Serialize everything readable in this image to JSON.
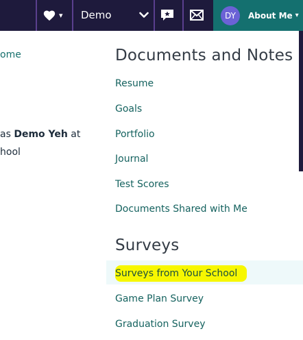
{
  "topbar": {
    "school": "Demo",
    "avatar_initials": "DY",
    "about_label": "About Me",
    "caret": "▾",
    "colors": {
      "bg": "#1e1a3c",
      "accent": "#14706f",
      "avatar": "#6b62d6"
    },
    "icons": [
      "heart-icon",
      "chevron-down-icon",
      "chat-icon",
      "mail-icon"
    ]
  },
  "left_partial": {
    "home_fragment": "ome",
    "logged_prefix": "as ",
    "logged_name": "Demo Yeh",
    "logged_suffix": " at",
    "school_fragment": "hool"
  },
  "documents": {
    "title": "Documents and Notes",
    "links": [
      "Resume",
      "Goals",
      "Portfolio",
      "Journal",
      "Test Scores",
      "Documents Shared with Me"
    ]
  },
  "surveys": {
    "title": "Surveys",
    "links": [
      "Surveys from Your School",
      "Game Plan Survey",
      "Graduation Survey"
    ],
    "highlighted_index": 0
  }
}
